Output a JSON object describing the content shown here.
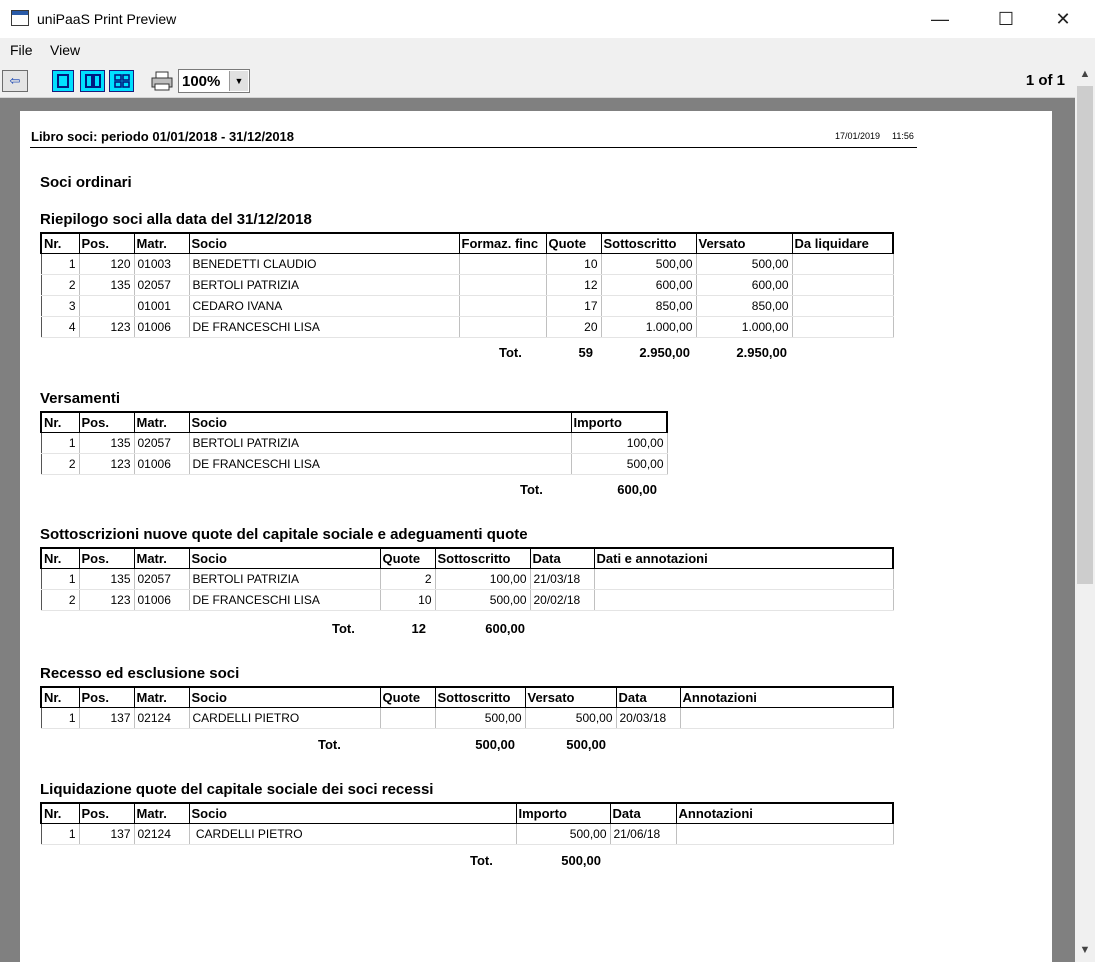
{
  "window": {
    "title": "uniPaaS Print Preview",
    "minimize": "—",
    "maximize": "☐",
    "close": "✕"
  },
  "menu": {
    "file": "File",
    "view": "View"
  },
  "toolbar": {
    "back_icon": "⇦",
    "zoom": "100%",
    "page_info": "1 of 1"
  },
  "report": {
    "title": "Libro soci: periodo 01/01/2018 - 31/12/2018",
    "date": "17/01/2019",
    "time": "11:56",
    "section_main": "Soci ordinari",
    "riepilogo": {
      "title": "Riepilogo soci alla data del 31/12/2018",
      "headers": [
        "Nr.",
        "Pos.",
        "Matr.",
        "Socio",
        "Formaz. finc",
        "Quote",
        "Sottoscritto",
        "Versato",
        "Da liquidare"
      ],
      "rows": [
        [
          "1",
          "120",
          "01003",
          "BENEDETTI CLAUDIO",
          "",
          "10",
          "500,00",
          "500,00",
          ""
        ],
        [
          "2",
          "135",
          "02057",
          "BERTOLI PATRIZIA",
          "",
          "12",
          "600,00",
          "600,00",
          ""
        ],
        [
          "3",
          "",
          "01001",
          "CEDARO IVANA",
          "",
          "17",
          "850,00",
          "850,00",
          ""
        ],
        [
          "4",
          "123",
          "01006",
          "DE FRANCESCHI LISA",
          "",
          "20",
          "1.000,00",
          "1.000,00",
          ""
        ]
      ],
      "total_label": "Tot.",
      "total_quote": "59",
      "total_sottoscritto": "2.950,00",
      "total_versato": "2.950,00"
    },
    "versamenti": {
      "title": "Versamenti",
      "headers": [
        "Nr.",
        "Pos.",
        "Matr.",
        "Socio",
        "Importo"
      ],
      "rows": [
        [
          "1",
          "135",
          "02057",
          "BERTOLI PATRIZIA",
          "100,00"
        ],
        [
          "2",
          "123",
          "01006",
          "DE FRANCESCHI LISA",
          "500,00"
        ]
      ],
      "total_label": "Tot.",
      "total_importo": "600,00"
    },
    "sottoscrizioni": {
      "title": "Sottoscrizioni nuove quote del capitale sociale e adeguamenti quote",
      "headers": [
        "Nr.",
        "Pos.",
        "Matr.",
        "Socio",
        "Quote",
        "Sottoscritto",
        "Data",
        "Dati e annotazioni"
      ],
      "rows": [
        [
          "1",
          "135",
          "02057",
          "BERTOLI PATRIZIA",
          "2",
          "100,00",
          "21/03/18",
          ""
        ],
        [
          "2",
          "123",
          "01006",
          "DE FRANCESCHI LISA",
          "10",
          "500,00",
          "20/02/18",
          ""
        ]
      ],
      "total_label": "Tot.",
      "total_quote": "12",
      "total_sottoscritto": "600,00"
    },
    "recesso": {
      "title": "Recesso ed esclusione soci",
      "headers": [
        "Nr.",
        "Pos.",
        "Matr.",
        "Socio",
        "Quote",
        "Sottoscritto",
        "Versato",
        "Data",
        "Annotazioni"
      ],
      "rows": [
        [
          "1",
          "137",
          "02124",
          "CARDELLI PIETRO",
          "",
          "500,00",
          "500,00",
          "20/03/18",
          ""
        ]
      ],
      "total_label": "Tot.",
      "total_sottoscritto": "500,00",
      "total_versato": "500,00"
    },
    "liquidazione": {
      "title": "Liquidazione quote del capitale sociale dei soci recessi",
      "headers": [
        "Nr.",
        "Pos.",
        "Matr.",
        "Socio",
        "Importo",
        "Data",
        "Annotazioni"
      ],
      "rows": [
        [
          "1",
          "137",
          "02124",
          " CARDELLI PIETRO",
          "500,00",
          "21/06/18",
          ""
        ]
      ],
      "total_label": "Tot.",
      "total_importo": "500,00"
    }
  }
}
